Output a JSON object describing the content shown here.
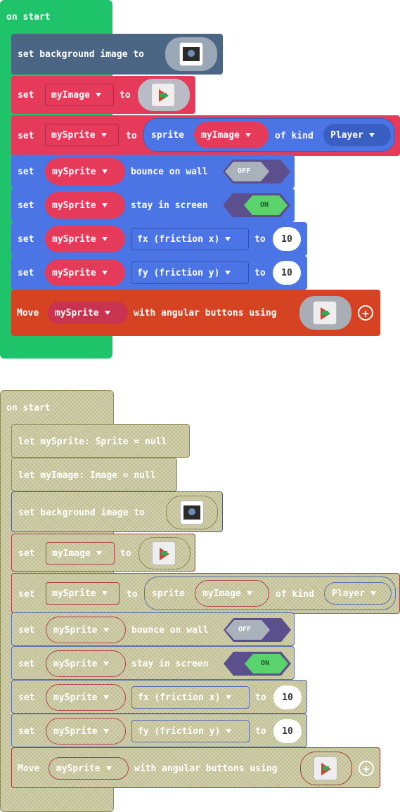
{
  "colors": {
    "event": "#1fc36a",
    "scene": "#4b6584",
    "variable": "#e63a5a",
    "sprite": "#4b74e4",
    "controller": "#d54322"
  },
  "active_stack": {
    "hat_label": "on start",
    "blocks": [
      {
        "kind": "set-bg",
        "words": [
          "set background image to"
        ],
        "icon": "background-image-icon"
      },
      {
        "kind": "set-var",
        "set": "set",
        "var": "myImage",
        "to": "to",
        "icon": "sprite-image-icon"
      },
      {
        "kind": "Player",
        "set": "set",
        "var": "mySprite",
        "to": "to",
        "sprite": "sprite",
        "image_var": "myImage",
        "of_kind": "of kind"
      },
      {
        "kind": "flag",
        "set": "set",
        "var": "mySprite",
        "label": "bounce on wall",
        "toggle": "OFF"
      },
      {
        "kind": "flag",
        "set": "set",
        "var": "mySprite",
        "label": "stay in screen",
        "toggle": "ON"
      },
      {
        "kind": "prop",
        "set": "set",
        "var": "mySprite",
        "prop": "fx (friction x)",
        "to": "to",
        "value": "10"
      },
      {
        "kind": "prop",
        "set": "set",
        "var": "mySprite",
        "prop": "fy (friction y)",
        "to": "to",
        "value": "10"
      },
      {
        "kind": "move",
        "move": "Move",
        "var": "mySprite",
        "label": "with angular buttons using",
        "icon": "sprite-image-icon"
      }
    ]
  },
  "disabled_stack": {
    "hat_label": "on start",
    "let1": "let mySprite: Sprite = null",
    "let2": "let myImage: Image = null",
    "set_bg": "set background image to",
    "set": "set",
    "to": "to",
    "myImage": "myImage",
    "mySprite": "mySprite",
    "sprite": "sprite",
    "of_kind": "of kind",
    "kind": "Player",
    "bounce": "bounce on wall",
    "stay": "stay in screen",
    "off": "OFF",
    "on": "ON",
    "fx": "fx (friction x)",
    "fy": "fy (friction y)",
    "ten": "10",
    "move": "Move",
    "angular": "with angular buttons using"
  }
}
